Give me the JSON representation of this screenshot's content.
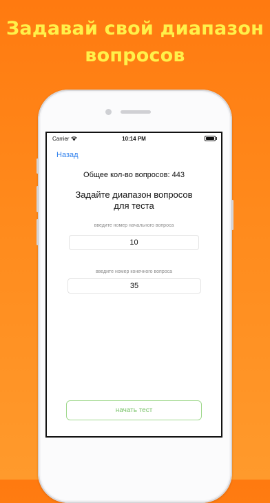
{
  "headline": {
    "line1": "Задавай свой диапазон",
    "line2": "вопросов"
  },
  "status_bar": {
    "carrier": "Carrier",
    "time": "10:14 PM",
    "icons": [
      "wifi-icon",
      "battery-icon"
    ]
  },
  "nav": {
    "back_label": "Назад"
  },
  "main": {
    "total_questions": "Общее кол-во вопросов: 443",
    "prompt_line1": "Задайте диапазон вопросов",
    "prompt_line2": "для теста",
    "start_field": {
      "label": "введите номер начального вопроса",
      "value": "10"
    },
    "end_field": {
      "label": "введите номер конечного вопроса",
      "value": "35"
    },
    "start_button_label": "начать тест"
  },
  "colors": {
    "background_top": "#ff7a10",
    "background_bottom": "#ff9a2c",
    "headline": "#fff14a",
    "link": "#2f80ed",
    "button_border": "#9fd88d",
    "button_text": "#7ac36a"
  }
}
